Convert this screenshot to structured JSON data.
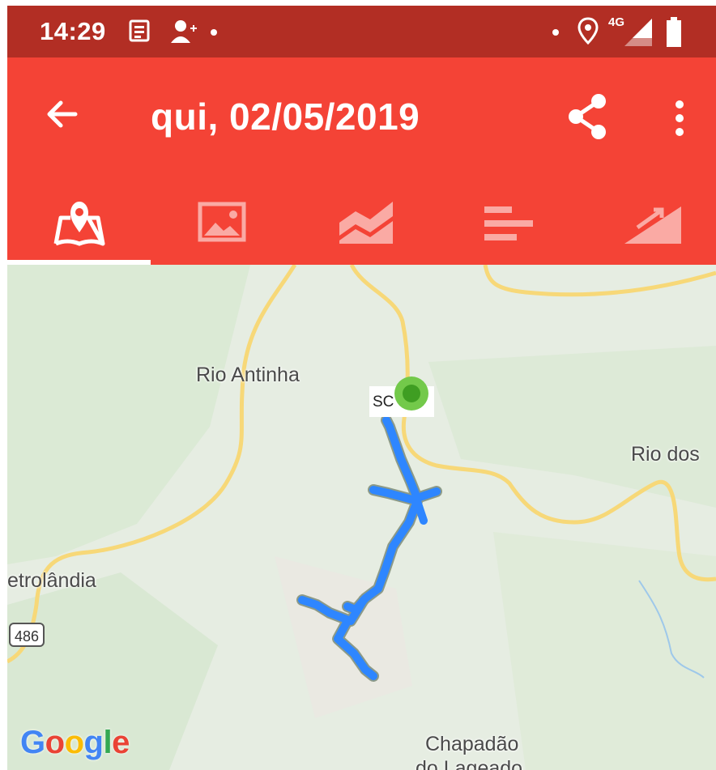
{
  "status_bar": {
    "time": "14:29",
    "network_label": "4G",
    "icons": [
      "news-icon",
      "person-add-icon",
      "notification-dot-icon",
      "location-icon",
      "signal-icon",
      "battery-icon"
    ]
  },
  "app_bar": {
    "title": "qui, 02/05/2019",
    "actions": [
      "back-arrow-icon",
      "share-icon",
      "more-vert-icon"
    ],
    "accent_color": "#f44336",
    "status_color": "#b22e24"
  },
  "tabs": [
    {
      "icon": "map-pin-icon",
      "selected": true
    },
    {
      "icon": "image-icon",
      "selected": false
    },
    {
      "icon": "area-chart-icon",
      "selected": false
    },
    {
      "icon": "bar-list-icon",
      "selected": false
    },
    {
      "icon": "elevation-icon",
      "selected": false
    }
  ],
  "map": {
    "labels": {
      "rio_antinha": "Rio Antinha",
      "rio_dos": "Rio dos",
      "petrolandia": "etrolândia",
      "route_shield": "486",
      "start_marker": "SC",
      "chapadao": "Chapadão",
      "chapadao_line2": "do Lageado"
    },
    "attribution": "Google",
    "track_color": "#2e86ff",
    "start_marker_color": "#5cb936"
  }
}
